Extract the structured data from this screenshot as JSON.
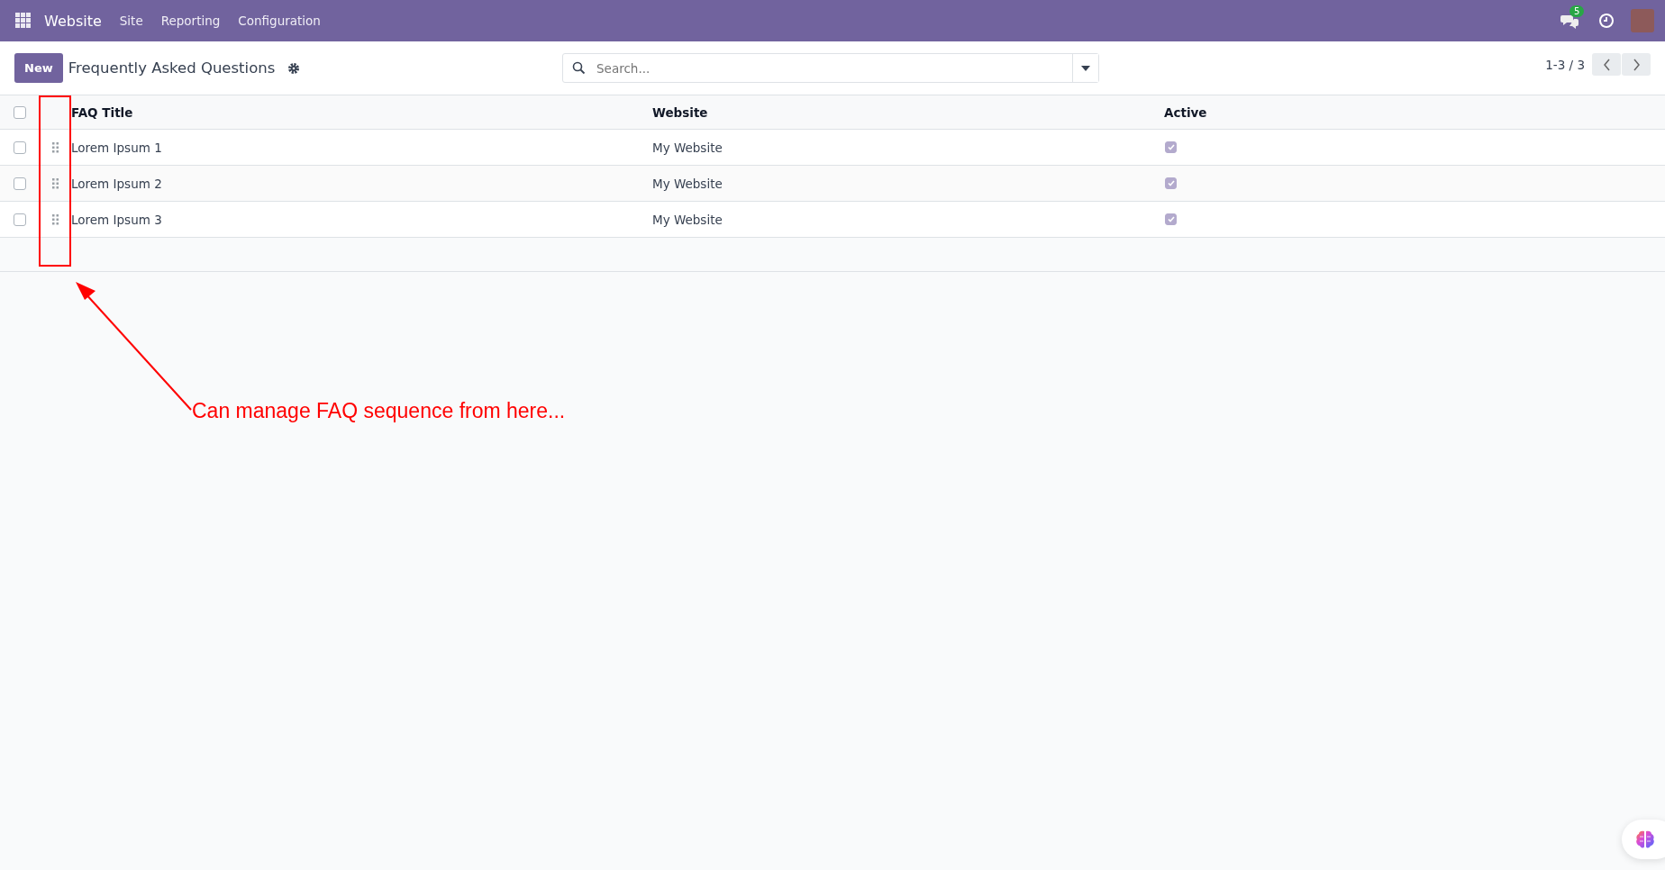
{
  "navbar": {
    "app": "Website",
    "menu": [
      "Site",
      "Reporting",
      "Configuration"
    ],
    "messages_badge": "5"
  },
  "control_panel": {
    "new_button": "New",
    "title": "Frequently Asked Questions",
    "search": {
      "placeholder": "Search..."
    },
    "pager": "1-3 / 3"
  },
  "table": {
    "columns": [
      "FAQ Title",
      "Website",
      "Active"
    ],
    "select_all": {
      "checked": false
    },
    "rows": [
      {
        "selected": false,
        "title": "Lorem Ipsum 1",
        "website": "My Website",
        "active": true
      },
      {
        "selected": false,
        "title": "Lorem Ipsum 2",
        "website": "My Website",
        "active": true
      },
      {
        "selected": false,
        "title": "Lorem Ipsum 3",
        "website": "My Website",
        "active": true
      }
    ]
  },
  "annotation": {
    "text": "Can manage FAQ sequence from here..."
  }
}
